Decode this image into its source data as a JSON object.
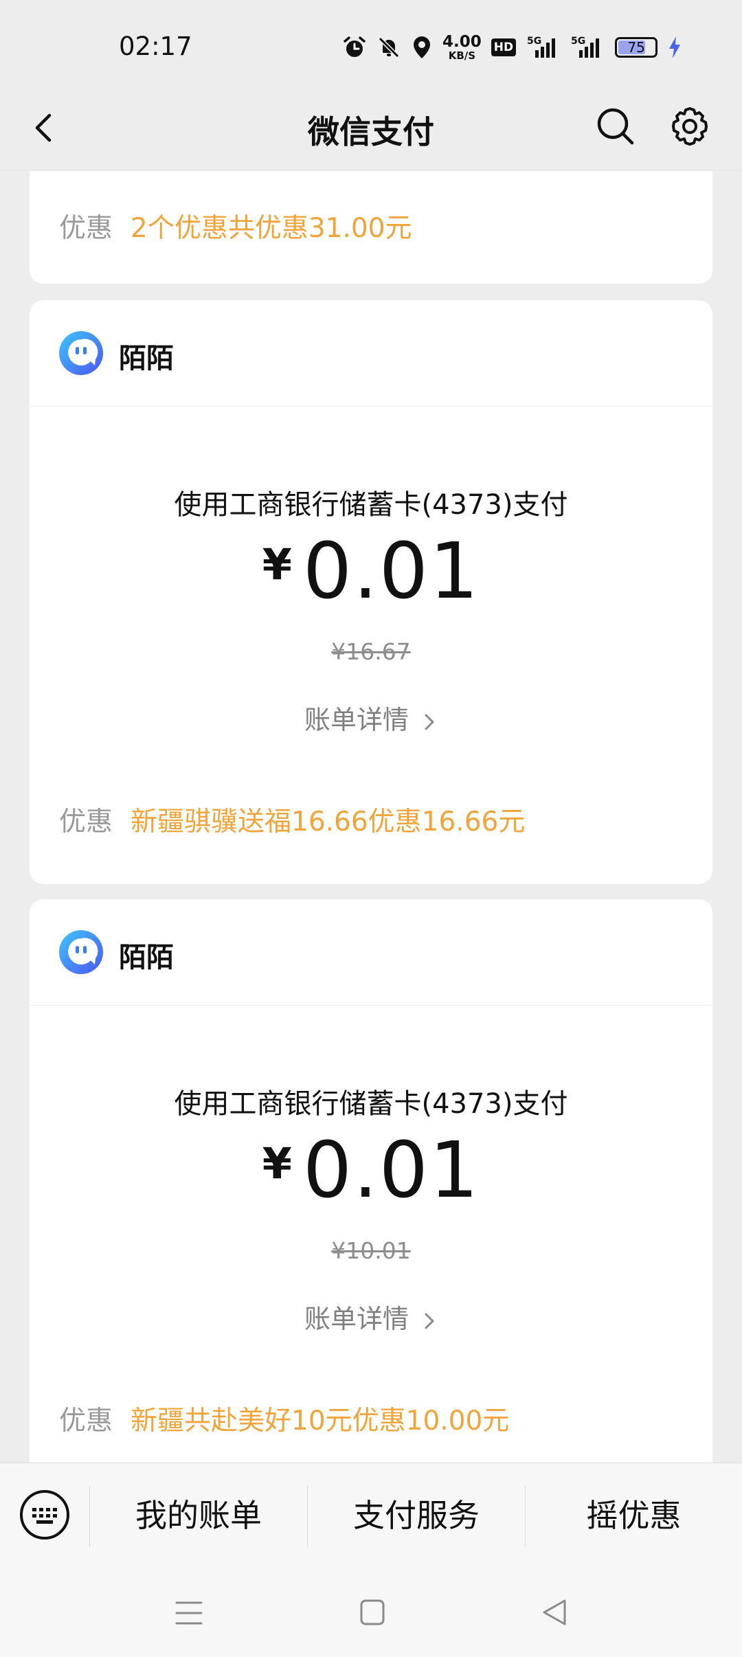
{
  "status_bar": {
    "time": "02:17",
    "net_speed_value": "4.00",
    "net_speed_unit": "KB/S",
    "hd_label": "HD",
    "signal_1_label": "5G",
    "signal_2_label": "5G",
    "battery_level": "75"
  },
  "nav": {
    "title": "微信支付"
  },
  "top_card": {
    "discount_label": "优惠",
    "discount_text": "2个优惠共优惠31.00元"
  },
  "transactions": [
    {
      "merchant": "陌陌",
      "pay_method": "使用工商银行储蓄卡(4373)支付",
      "currency": "¥",
      "amount": "0.01",
      "original_amount": "¥16.67",
      "bill_detail": "账单详情",
      "discount_label": "优惠",
      "discount_text": "新疆骐骥送福16.66优惠16.66元"
    },
    {
      "merchant": "陌陌",
      "pay_method": "使用工商银行储蓄卡(4373)支付",
      "currency": "¥",
      "amount": "0.01",
      "original_amount": "¥10.01",
      "bill_detail": "账单详情",
      "discount_label": "优惠",
      "discount_text": "新疆共赴美好10元优惠10.00元"
    }
  ],
  "bottom_menu": {
    "items": [
      "我的账单",
      "支付服务",
      "摇优惠"
    ]
  },
  "colors": {
    "accent_orange": "#f0a43a",
    "background": "#ededed",
    "card": "#ffffff"
  },
  "icons": [
    "back-arrow-icon",
    "search-icon",
    "settings-gear-icon",
    "momo-logo-icon",
    "chevron-right-icon",
    "keyboard-icon",
    "alarm-icon",
    "mute-bell-icon",
    "location-icon",
    "battery-icon",
    "charging-icon",
    "menu-lines-icon",
    "home-square-icon",
    "back-triangle-icon"
  ]
}
